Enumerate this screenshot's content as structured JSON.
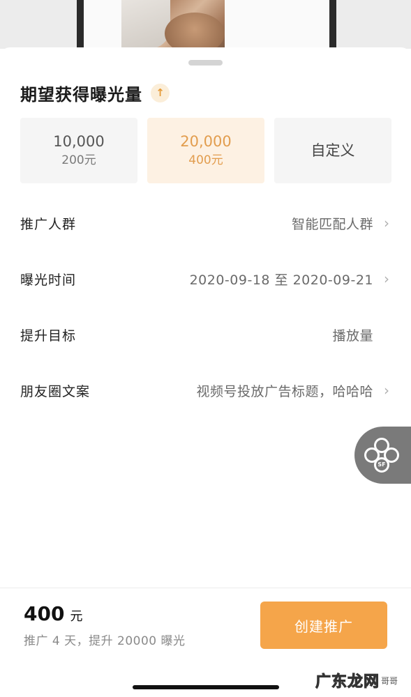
{
  "sheet": {
    "title": "期望获得曝光量",
    "title_icon": "up-arrow-icon"
  },
  "options": [
    {
      "main": "10,000",
      "sub": "200元",
      "selected": false
    },
    {
      "main": "20,000",
      "sub": "400元",
      "selected": true
    },
    {
      "main": "自定义",
      "sub": "",
      "selected": false
    }
  ],
  "rows": [
    {
      "label": "推广人群",
      "value": "智能匹配人群",
      "has_chevron": true
    },
    {
      "label": "曝光时间",
      "value": "2020-09-18 至 2020-09-21",
      "has_chevron": true
    },
    {
      "label": "提升目标",
      "value": "播放量",
      "has_chevron": false
    },
    {
      "label": "朋友圈文案",
      "value": "视频号投放广告标题，哈哈哈",
      "has_chevron": true
    }
  ],
  "footer": {
    "price": "400",
    "unit": "元",
    "summary": "推广 4 天，提升 20000 曝光",
    "create_button": "创建推广"
  },
  "watermark": {
    "text": "广东龙网",
    "small": "哥哥"
  },
  "colors": {
    "accent": "#f5a54a",
    "selected_bg": "#fdf1e3",
    "selected_text": "#e29d4e"
  }
}
